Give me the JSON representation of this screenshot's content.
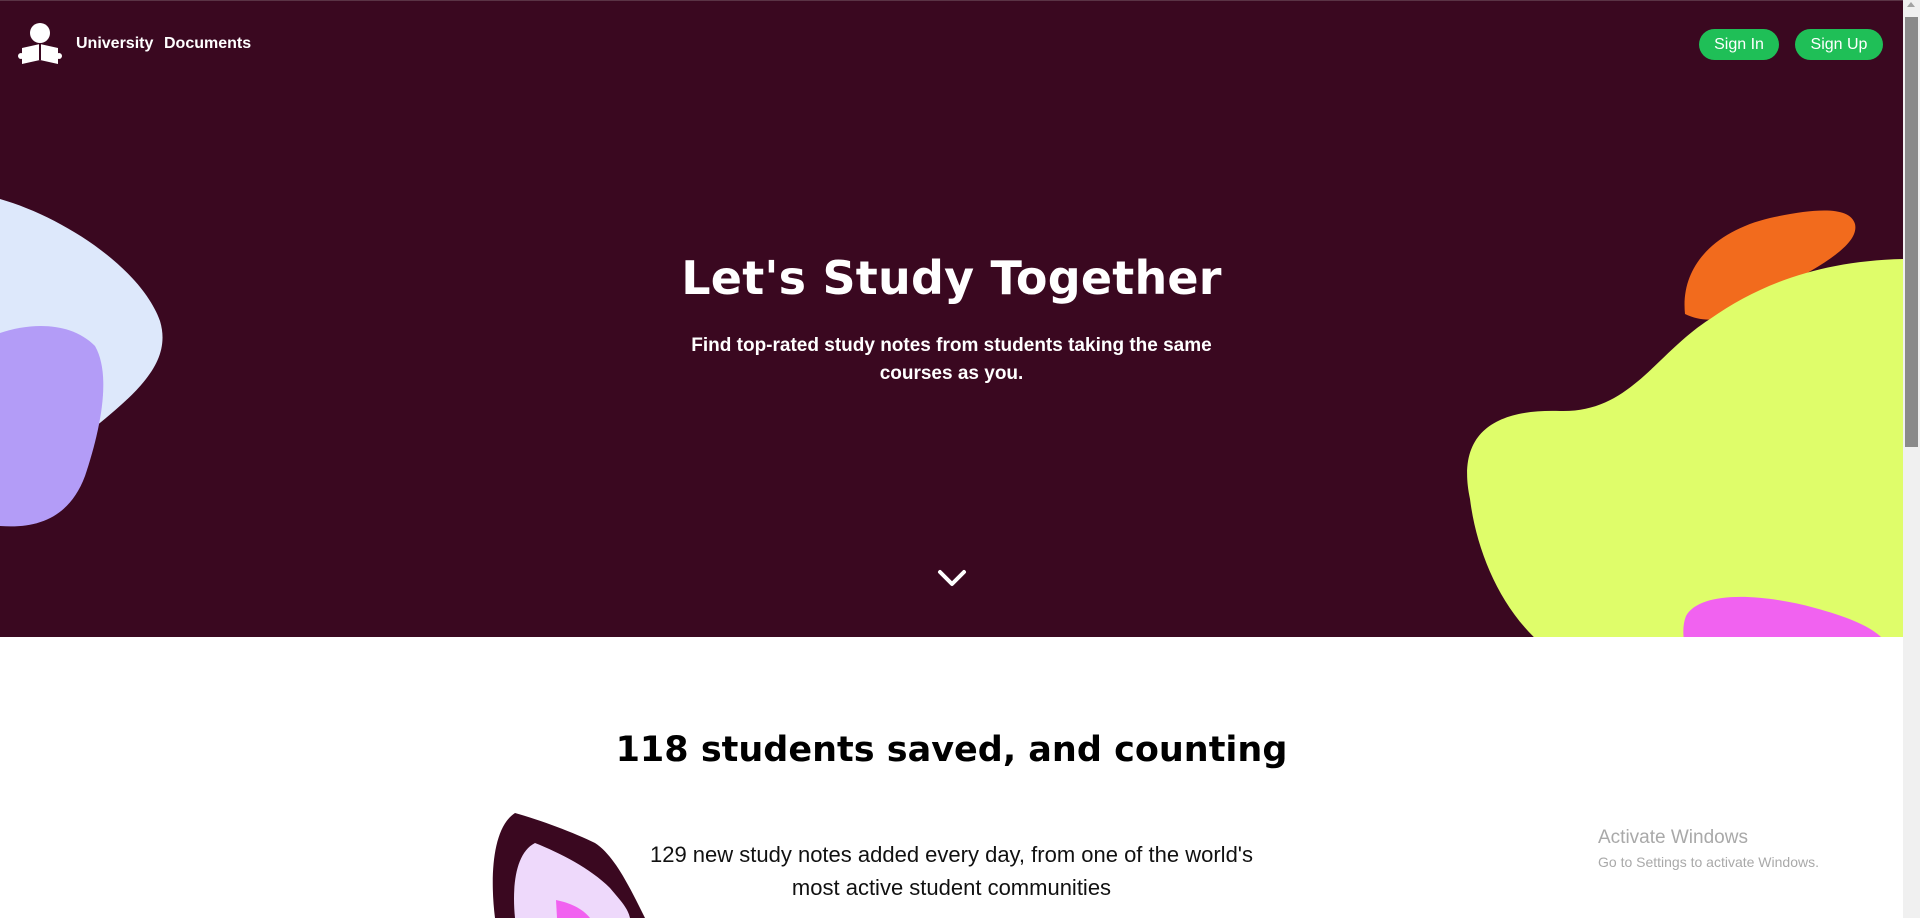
{
  "nav": {
    "links": [
      {
        "label": "University"
      },
      {
        "label": "Documents"
      }
    ],
    "sign_in": "Sign In",
    "sign_up": "Sign Up"
  },
  "hero": {
    "title": "Let's Study Together",
    "subtitle": "Find top-rated study notes from students taking the same courses as you."
  },
  "stats": {
    "heading": "118 students saved, and counting",
    "notes_line": "129 new study notes added every day, from one of the world's most active student communities"
  },
  "os_overlay": {
    "title": "Activate Windows",
    "subtitle": "Go to Settings to activate Windows."
  },
  "colors": {
    "hero_background": "#3a0820",
    "button_green": "#1fbf57",
    "blob_lavender_light": "#dde8fb",
    "blob_purple": "#b39cf7",
    "blob_orange": "#f26b1d",
    "blob_lime": "#dffd6a",
    "blob_green": "#2fbf14",
    "blob_pink": "#f162f0"
  },
  "icons": {
    "logo": "person-reading-book-icon",
    "scroll": "chevron-down-icon"
  }
}
